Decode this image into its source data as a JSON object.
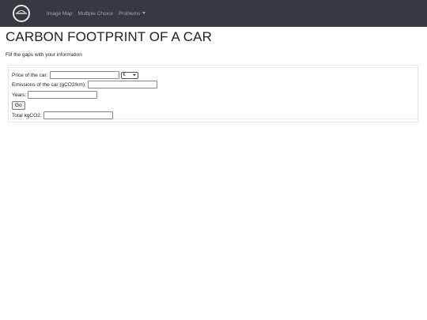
{
  "nav": {
    "logo": "brand-logo",
    "items": [
      "Image Map",
      "Multiple Choice",
      "Problems"
    ]
  },
  "page": {
    "title": "CARBON FOOTPRINT OF A CAR",
    "subtitle": "Fill the gaps with your information"
  },
  "form": {
    "price_label": "Price of the car:",
    "price_value": "",
    "currency_selected": "€",
    "emissions_label": "Emissions of the car (gCO2/km):",
    "emissions_value": "",
    "years_label": "Years:",
    "years_value": "",
    "go_label": "Go",
    "total_label": "Total kgCO2:",
    "total_value": ""
  },
  "colors": {
    "navbar": "#343a40",
    "nav_text": "#a0a4a8"
  }
}
